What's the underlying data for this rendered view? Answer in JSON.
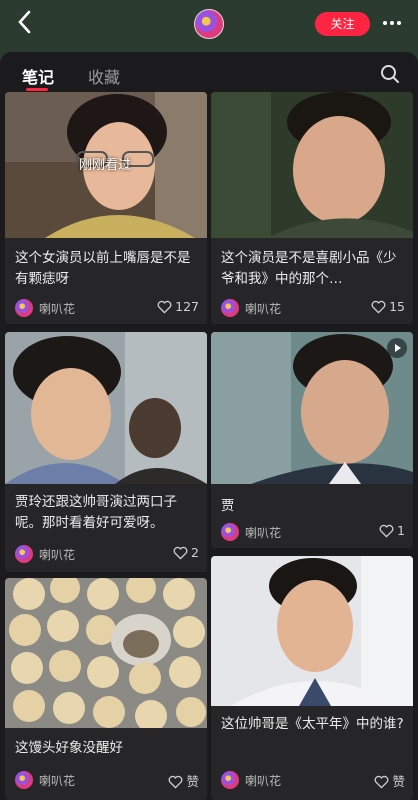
{
  "header": {
    "back_icon": "chevron-left-icon",
    "follow_label": "关注",
    "more_icon": "more-horizontal-icon",
    "accent_color": "#ff2442"
  },
  "tabs": [
    {
      "label": "笔记",
      "active": true
    },
    {
      "label": "收藏",
      "active": false
    }
  ],
  "cards": [
    {
      "title": "这个女演员以前上嘴唇是不是有颗痣呀",
      "author": "喇叭花",
      "likes": "127",
      "overlay": "刚刚看过"
    },
    {
      "title": "这个演员是不是喜剧小品《少爷和我》中的那个…",
      "author": "喇叭花",
      "likes": "15"
    },
    {
      "title": "贾玲还跟这帅哥演过两口子呢。那时看着好可爱呀。",
      "author": "喇叭花",
      "likes": "2"
    },
    {
      "title": "贾",
      "author": "喇叭花",
      "likes": "1",
      "has_video": true
    },
    {
      "title": "这馒头好象没醒好",
      "author": "喇叭花",
      "likes": "赞"
    },
    {
      "title": "这位帅哥是《太平年》中的谁?",
      "author": "喇叭花",
      "likes": "赞"
    }
  ]
}
